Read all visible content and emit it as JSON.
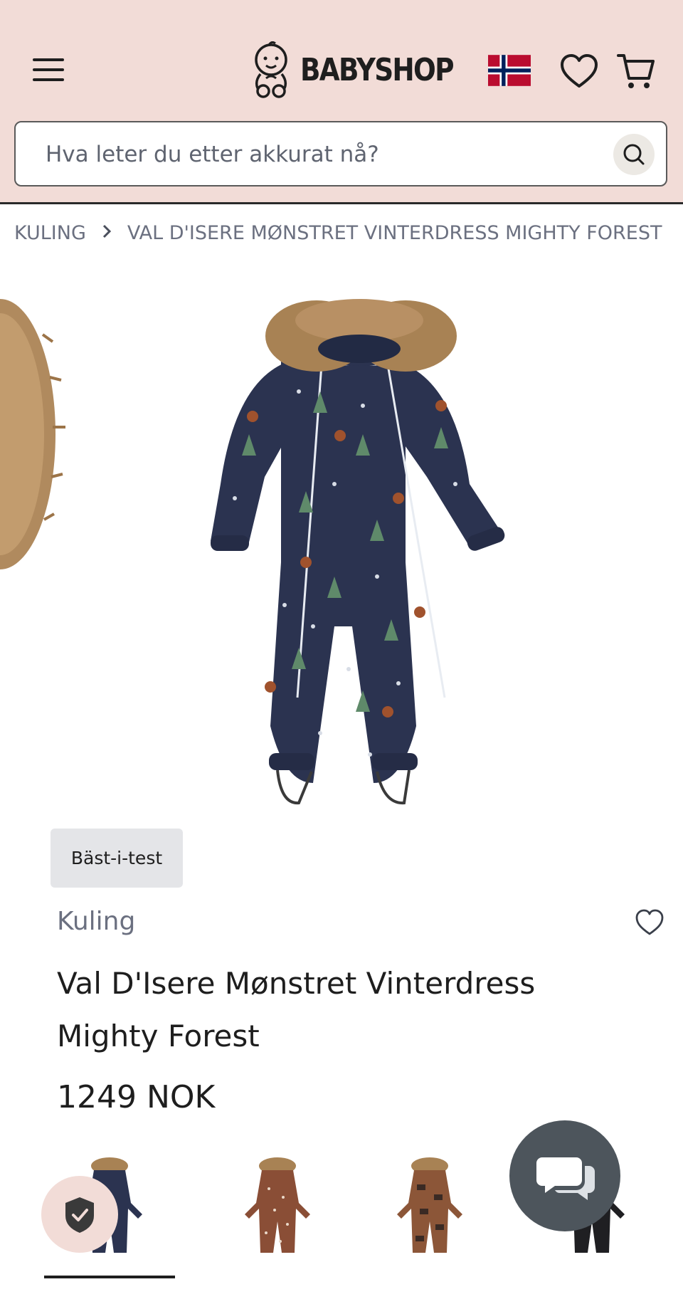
{
  "header": {
    "logo_text": "BABYSHOP",
    "background": "#f2dcd7",
    "icons": [
      "menu-icon",
      "baby-logo-icon",
      "norway-flag-icon",
      "heart-icon",
      "cart-icon"
    ]
  },
  "search": {
    "placeholder": "Hva leter du etter akkurat nå?",
    "value": "",
    "icon": "search-icon"
  },
  "breadcrumb": {
    "items": [
      "KULING",
      "VAL D'ISERE MØNSTRET VINTERDRESS MIGHTY FOREST"
    ],
    "separator_icon": "chevron-right-icon"
  },
  "product": {
    "badge": "Bäst-i-test",
    "brand": "Kuling",
    "title_line1": "Val D'Isere Mønstret Vinterdress",
    "title_line2": "Mighty Forest",
    "price": "1249 NOK",
    "wishlist_icon": "heart-outline-icon"
  },
  "thumbnails": {
    "colors": [
      "#2b3350",
      "#8a4e36",
      "#8c5638",
      "#1f1f22"
    ],
    "selected_index": 0
  },
  "floating": {
    "trust_icon": "shield-check-icon",
    "chat_icon": "chat-bubbles-icon",
    "chat_color": "#4d555c"
  }
}
